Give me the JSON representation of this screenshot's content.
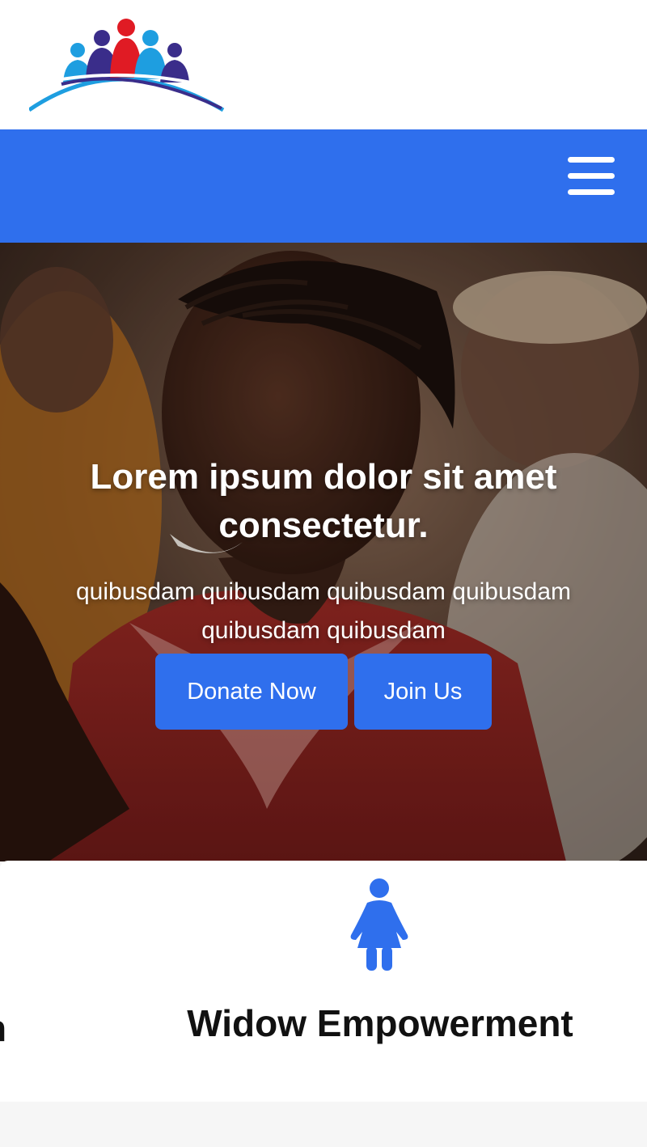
{
  "header": {
    "logo_name": "people-community-logo",
    "colors": {
      "brand_blue": "#2f6fed",
      "logo_navy": "#3a2d8a",
      "logo_cyan": "#1e9ee0",
      "logo_red": "#e01b24"
    }
  },
  "navbar": {
    "menu_icon": "hamburger-menu-icon",
    "background": "#2f6fed"
  },
  "hero": {
    "title": "Lorem ipsum dolor sit amet consectetur.",
    "subtitle": "quibusdam quibusdam quibusdam quibusdam quibusdam quibusdam",
    "buttons": {
      "donate": "Donate Now",
      "join": "Join Us"
    }
  },
  "programs": {
    "previous_card_fragment": "h",
    "card": {
      "icon": "woman-icon",
      "title": "Widow Empowerment"
    }
  }
}
